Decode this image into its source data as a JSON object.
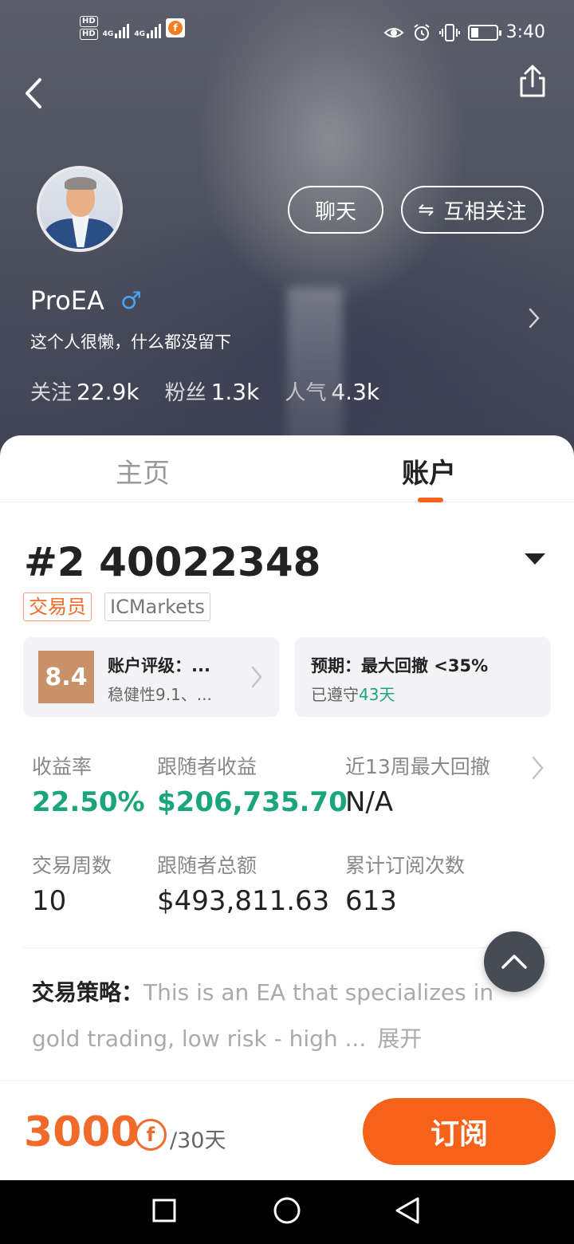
{
  "status_bar": {
    "hd1": "HD",
    "hd2": "HD",
    "net1": "4G",
    "net2": "4G",
    "app_badge_glyph": "f",
    "time": "3:40",
    "icons": [
      "eye-icon",
      "alarm-icon",
      "vibrate-icon",
      "battery-icon"
    ],
    "battery_level": 0.3
  },
  "header": {
    "chat_label": "聊天",
    "follow_icon": "⇋",
    "follow_label": "互相关注",
    "username": "ProEA",
    "gender_symbol": "♂",
    "bio": "这个人很懒，什么都没留下",
    "stats": [
      {
        "label": "关注",
        "value": "22.9k"
      },
      {
        "label": "粉丝",
        "value": "1.3k"
      },
      {
        "label": "人气",
        "value": "4.3k"
      }
    ]
  },
  "tabs": {
    "home": "主页",
    "account": "账户"
  },
  "account": {
    "title": "#2 40022348",
    "tag_role": "交易员",
    "tag_broker": "ICMarkets",
    "rating_score": "8.4",
    "rating_title": "账户评级：...",
    "rating_detail": "稳健性9.1、...",
    "expect_title": "预期：最大回撤 <35%",
    "expect_prefix": "已遵守",
    "expect_days": "43天"
  },
  "metrics": [
    {
      "label": "收益率",
      "value": "22.50%"
    },
    {
      "label": "跟随者收益",
      "value": "$206,735.70"
    },
    {
      "label": "近13周最大回撤",
      "value": "N/A"
    },
    {
      "label": "交易周数",
      "value": "10"
    },
    {
      "label": "跟随者总额",
      "value": "$493,811.63"
    },
    {
      "label": "累计订阅次数",
      "value": "613"
    }
  ],
  "strategy": {
    "label": "交易策略：",
    "text": "This is an EA that specializes in gold trading, low risk - high ...",
    "expand": "展开"
  },
  "subscription": {
    "price": "3000",
    "coin_glyph": "f",
    "period": "/30天",
    "button": "订阅"
  },
  "colors": {
    "accent": "#f6621a",
    "green": "#1aa67a",
    "score_bg": "#c8916a"
  }
}
